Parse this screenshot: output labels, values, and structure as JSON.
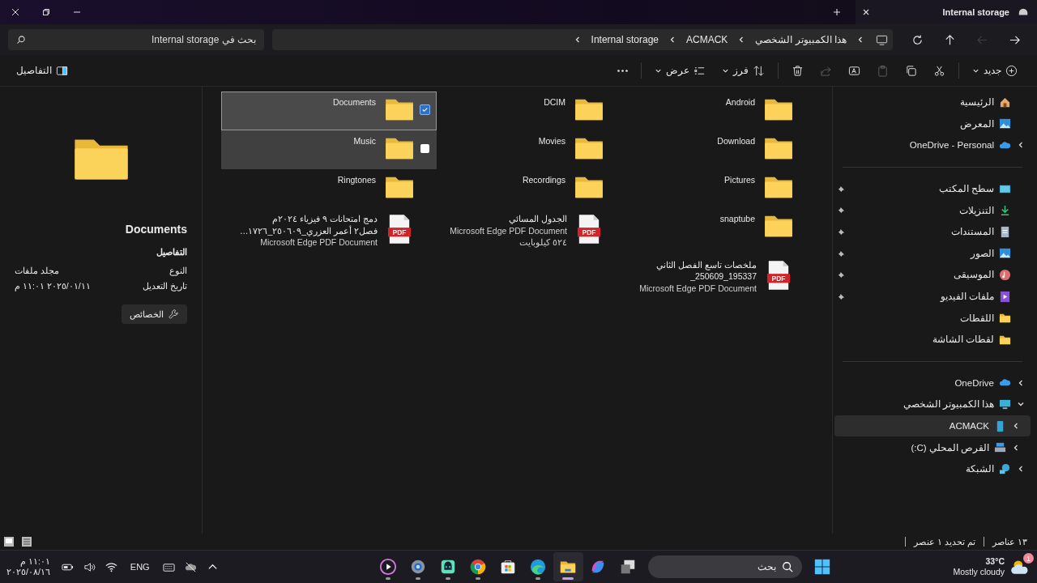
{
  "window": {
    "tab": {
      "title": "Internal storage"
    }
  },
  "navigation": [
    {
      "kind": "back",
      "disabled": false
    },
    {
      "kind": "forward",
      "disabled": true
    },
    {
      "kind": "up",
      "disabled": false
    },
    {
      "kind": "refresh",
      "disabled": false
    }
  ],
  "breadcrumb": [
    "هذا الكمبيوتر الشخصي",
    "ACMACK",
    "Internal storage"
  ],
  "search": {
    "placeholder": "بحث في Internal storage"
  },
  "commands": [
    {
      "kind": "new",
      "label": "جديد",
      "disabled": false
    },
    {
      "kind": "cut",
      "disabled": false
    },
    {
      "kind": "copy",
      "disabled": false
    },
    {
      "kind": "paste",
      "disabled": true
    },
    {
      "kind": "rename",
      "disabled": false
    },
    {
      "kind": "share",
      "disabled": true
    },
    {
      "kind": "delete",
      "disabled": false
    },
    {
      "kind": "sort",
      "label": "فرز",
      "disabled": false
    },
    {
      "kind": "view",
      "label": "عرض",
      "disabled": false
    },
    {
      "kind": "more",
      "disabled": false
    }
  ],
  "details_toggle": {
    "label": "التفاصيل",
    "on": true
  },
  "nav": {
    "sections": [
      [
        {
          "label": "الرئيسية",
          "kind": "home",
          "selected": false,
          "pinned": false
        },
        {
          "label": "المعرض",
          "kind": "gallery",
          "selected": false,
          "pinned": false
        },
        {
          "label": "OneDrive - Personal",
          "kind": "cloud",
          "selected": false,
          "pinned": false,
          "expanded": false
        }
      ],
      [
        {
          "label": "سطح المكتب",
          "kind": "desktop",
          "selected": false,
          "pinned": true
        },
        {
          "label": "التنزيلات",
          "kind": "download",
          "selected": false,
          "pinned": true
        },
        {
          "label": "المستندات",
          "kind": "document",
          "selected": false,
          "pinned": true
        },
        {
          "label": "الصور",
          "kind": "pictures",
          "selected": false,
          "pinned": true
        },
        {
          "label": "الموسيقى",
          "kind": "music",
          "selected": false,
          "pinned": true
        },
        {
          "label": "ملفات الفيديو",
          "kind": "video",
          "selected": false,
          "pinned": true
        },
        {
          "label": "اللقطات",
          "kind": "folder",
          "selected": false,
          "pinned": false
        },
        {
          "label": "لقطات الشاشة",
          "kind": "folder",
          "selected": false,
          "pinned": false
        }
      ],
      [
        {
          "label": "OneDrive",
          "kind": "cloud",
          "selected": false,
          "pinned": false,
          "expanded": false
        },
        {
          "label": "هذا الكمبيوتر الشخصي",
          "kind": "pc",
          "selected": false,
          "pinned": false,
          "expanded": true,
          "children": [
            {
              "label": "ACMACK",
              "kind": "phone",
              "selected": true,
              "pinned": false,
              "expanded": false
            },
            {
              "label": "القرص المحلي (C:)",
              "kind": "drive",
              "selected": false,
              "pinned": false,
              "expanded": false
            }
          ]
        },
        {
          "label": "الشبكة",
          "kind": "network",
          "selected": false,
          "pinned": false,
          "expanded": false
        }
      ]
    ]
  },
  "content": {
    "items": [
      {
        "kind": "folder",
        "name_lines": [
          "Android"
        ],
        "selected": false,
        "hovered": false
      },
      {
        "kind": "folder",
        "name_lines": [
          "DCIM"
        ],
        "selected": false,
        "hovered": false
      },
      {
        "kind": "folder",
        "name_lines": [
          "Documents"
        ],
        "selected": true,
        "hovered": false
      },
      {
        "kind": "folder",
        "name_lines": [
          "Download"
        ],
        "selected": false,
        "hovered": false
      },
      {
        "kind": "folder",
        "name_lines": [
          "Movies"
        ],
        "selected": false,
        "hovered": false
      },
      {
        "kind": "folder",
        "name_lines": [
          "Music"
        ],
        "selected": false,
        "hovered": true
      },
      {
        "kind": "folder",
        "name_lines": [
          "Pictures"
        ],
        "selected": false,
        "hovered": false
      },
      {
        "kind": "folder",
        "name_lines": [
          "Recordings"
        ],
        "selected": false,
        "hovered": false
      },
      {
        "kind": "folder",
        "name_lines": [
          "Ringtones"
        ],
        "selected": false,
        "hovered": false
      },
      {
        "kind": "folder",
        "name_lines": [
          "snaptube"
        ],
        "selected": false,
        "hovered": false
      },
      {
        "kind": "pdf",
        "icon_label": "PDF",
        "name_lines": [
          "الجدول المسائي"
        ],
        "info": [
          "Microsoft Edge PDF Document",
          "٥٢٤ كيلوبايت"
        ],
        "selected": false,
        "hovered": false
      },
      {
        "kind": "pdf",
        "icon_label": "PDF",
        "name_lines": [
          "دمج امتحانات ٩ فيزياء ٢٠٢٤م",
          "فصل٢ أعمر العزري_٢٥٠٦٠٩_١٧٢٦…"
        ],
        "info": [
          "Microsoft Edge PDF Document"
        ],
        "selected": false,
        "hovered": false
      },
      {
        "kind": "pdf",
        "icon_label": "PDF",
        "name_lines": [
          "ملخصات تاسع الفصل الثاني",
          "_250609_195337"
        ],
        "info": [
          "Microsoft Edge PDF Document"
        ],
        "selected": false,
        "hovered": false
      }
    ]
  },
  "details": {
    "title": "Documents",
    "heading": "التفاصيل",
    "properties": [
      {
        "label": "النوع",
        "value": "مجلد ملفات"
      },
      {
        "label": "تاريخ التعديل",
        "value": "٢٠٢٥/٠١/١١ ١١:٠١ م"
      }
    ],
    "button": "الخصائص"
  },
  "status_bar": {
    "item_count": "١٣ عناصر",
    "selection": "تم تحديد ١ عنصر"
  },
  "taskbar": {
    "weather": {
      "temperature": "33°C",
      "condition": "Mostly cloudy",
      "badge": "1"
    },
    "search": {
      "placeholder": "بحث"
    },
    "apps": [
      {
        "kind": "taskview",
        "running": false,
        "active": false
      },
      {
        "kind": "copilot",
        "running": false,
        "active": false
      },
      {
        "kind": "explorer",
        "running": true,
        "active": true
      },
      {
        "kind": "edge",
        "running": true,
        "active": false
      },
      {
        "kind": "store",
        "running": false,
        "active": false
      },
      {
        "kind": "chrome",
        "running": true,
        "active": false
      },
      {
        "kind": "chat",
        "running": true,
        "active": false
      },
      {
        "kind": "settings",
        "running": true,
        "active": false
      },
      {
        "kind": "player",
        "running": true,
        "active": false
      }
    ],
    "language": "ENG",
    "time": "١١:٠١ م",
    "date": "٢٠٢٥/٠٨/١٦"
  }
}
